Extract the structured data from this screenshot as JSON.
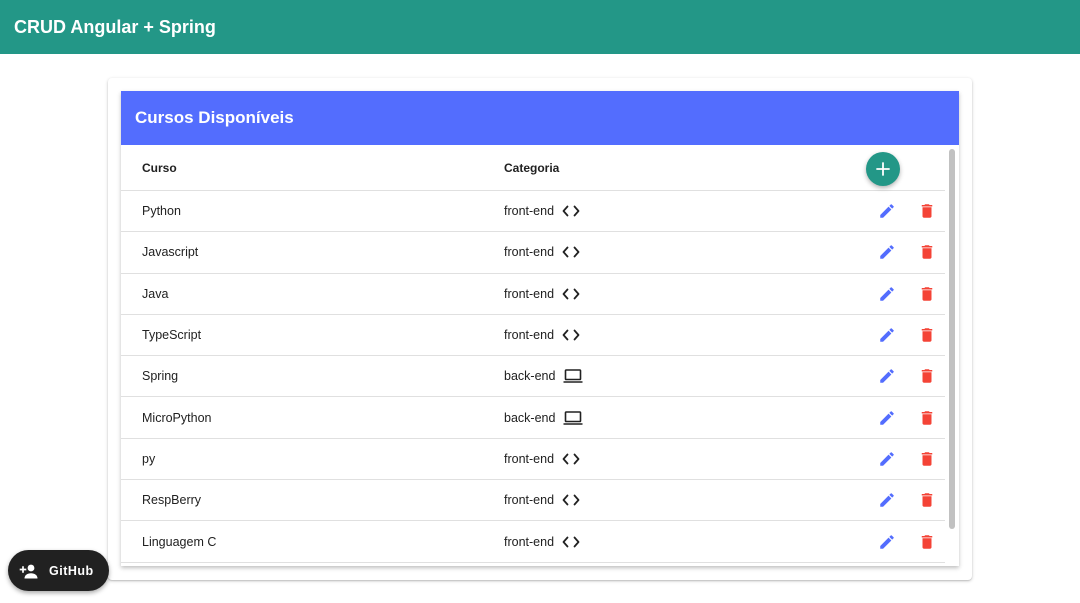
{
  "toolbar": {
    "title": "CRUD Angular + Spring"
  },
  "card": {
    "title": "Cursos Disponíveis",
    "columns": {
      "course": "Curso",
      "category": "Categoria"
    },
    "rows": [
      {
        "name": "Python",
        "category": "front-end",
        "icon": "code-icon"
      },
      {
        "name": "Javascript",
        "category": "front-end",
        "icon": "code-icon"
      },
      {
        "name": "Java",
        "category": "front-end",
        "icon": "code-icon"
      },
      {
        "name": "TypeScript",
        "category": "front-end",
        "icon": "code-icon"
      },
      {
        "name": "Spring",
        "category": "back-end",
        "icon": "laptop-icon"
      },
      {
        "name": "MicroPython",
        "category": "back-end",
        "icon": "laptop-icon"
      },
      {
        "name": "py",
        "category": "front-end",
        "icon": "code-icon"
      },
      {
        "name": "RespBerry",
        "category": "front-end",
        "icon": "code-icon"
      },
      {
        "name": "Linguagem C",
        "category": "front-end",
        "icon": "code-icon"
      }
    ]
  },
  "github": {
    "label": "GitHub",
    "icon": "person-add-icon"
  },
  "colors": {
    "toolbar": "#239787",
    "header": "#536dfe",
    "edit": "#536dfe",
    "delete": "#f44336",
    "fab": "#239787"
  }
}
